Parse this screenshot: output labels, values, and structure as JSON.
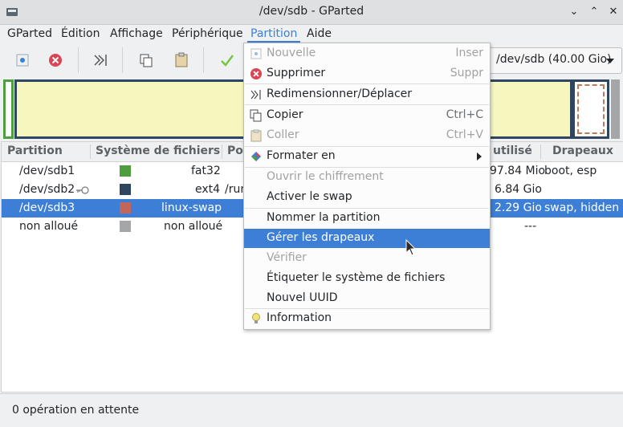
{
  "window": {
    "title": "/dev/sdb - GParted"
  },
  "menubar": [
    {
      "label": "GParted"
    },
    {
      "label": "Édition"
    },
    {
      "label": "Affichage"
    },
    {
      "label": "Périphérique"
    },
    {
      "label": "Partition"
    },
    {
      "label": "Aide"
    }
  ],
  "toolbar": {
    "device_label": "/dev/sdb (40.00 Gio)",
    "icons": [
      "new-partition-icon",
      "delete-icon",
      "resize-icon",
      "copy-icon",
      "paste-icon",
      "apply-icon"
    ]
  },
  "table": {
    "headers": [
      "Partition",
      "Système de fichiers",
      "Poi",
      "utilisé",
      "Drapeaux"
    ],
    "rows": [
      {
        "partition": "/dev/sdb1",
        "filesystem": "fat32",
        "color": "#4c9e3f",
        "mount": "",
        "used": "97.84 Mio",
        "flags": "boot, esp"
      },
      {
        "partition": "/dev/sdb2",
        "filesystem": "ext4",
        "color": "#2f4560",
        "mount": "/run",
        "used": "6.84 Gio",
        "flags": ""
      },
      {
        "partition": "/dev/sdb3",
        "filesystem": "linux-swap",
        "color": "#c0665a",
        "mount": "",
        "used": "2.29 Gio",
        "flags": "swap, hidden"
      },
      {
        "partition": "non alloué",
        "filesystem": "non alloué",
        "color": "#a4a6a8",
        "mount": "",
        "used": "---",
        "flags": ""
      }
    ]
  },
  "status": {
    "text": "0 opération en attente"
  },
  "partition_menu": {
    "items": [
      {
        "label": "Nouvelle",
        "shortcut": "Inser",
        "disabled": true
      },
      {
        "label": "Supprimer",
        "shortcut": "Suppr",
        "disabled": false
      },
      {
        "label": "Redimensionner/Déplacer",
        "shortcut": "",
        "disabled": false
      },
      {
        "label": "Copier",
        "shortcut": "Ctrl+C",
        "disabled": false
      },
      {
        "label": "Coller",
        "shortcut": "Ctrl+V",
        "disabled": true
      },
      {
        "label": "Formater en",
        "shortcut": "",
        "disabled": false
      },
      {
        "label": "Ouvrir le chiffrement",
        "shortcut": "",
        "disabled": true
      },
      {
        "label": "Activer le swap",
        "shortcut": "",
        "disabled": false
      },
      {
        "label": "Nommer la partition",
        "shortcut": "",
        "disabled": false
      },
      {
        "label": "Gérer les drapeaux",
        "shortcut": "",
        "disabled": false,
        "highlighted": true
      },
      {
        "label": "Vérifier",
        "shortcut": "",
        "disabled": true
      },
      {
        "label": "Étiqueter le système de fichiers",
        "shortcut": "",
        "disabled": false
      },
      {
        "label": "Nouvel UUID",
        "shortcut": "",
        "disabled": false
      },
      {
        "label": "Information",
        "shortcut": "",
        "disabled": false
      }
    ]
  }
}
